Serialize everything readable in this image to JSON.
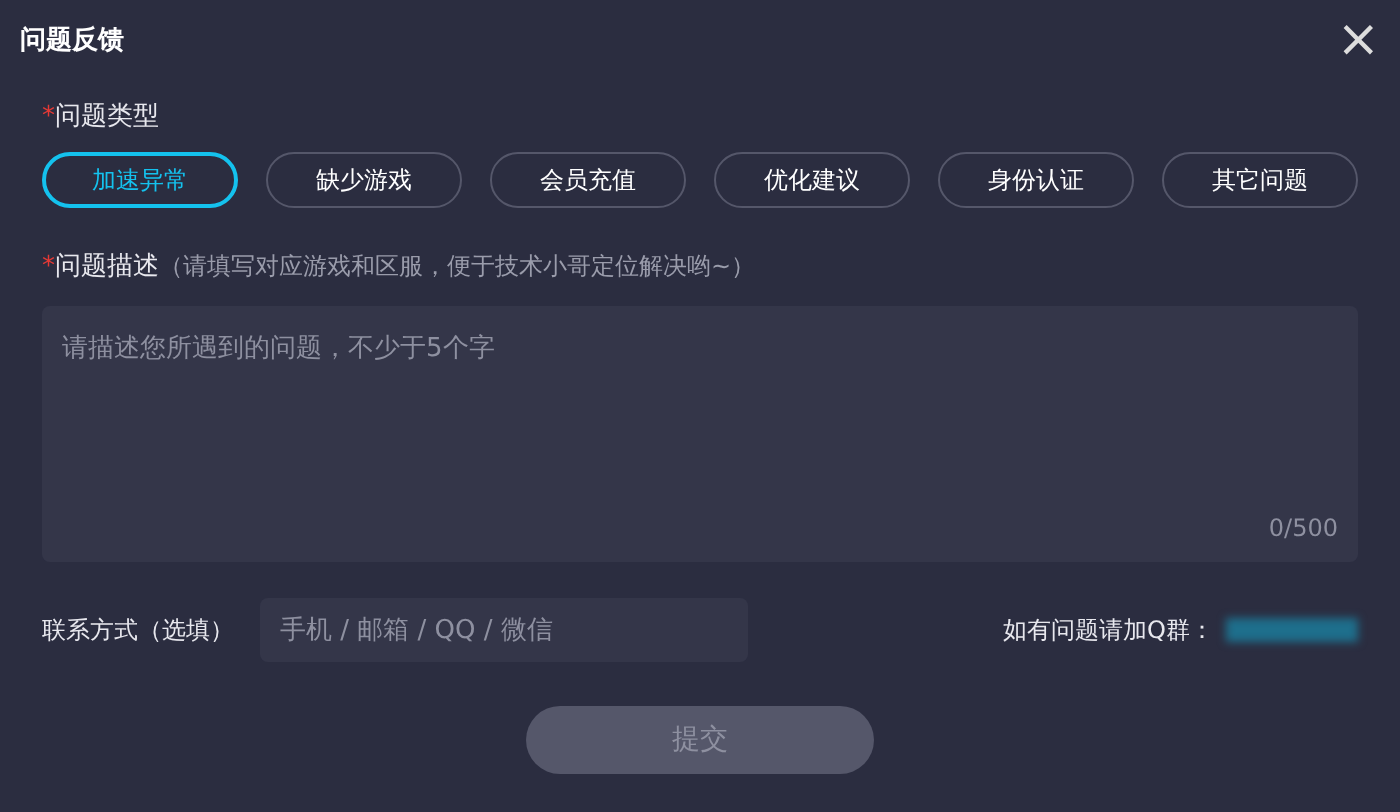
{
  "dialog": {
    "title": "问题反馈",
    "close": "×"
  },
  "type_field": {
    "required_mark": "*",
    "label": "问题类型"
  },
  "types": [
    {
      "label": "加速异常",
      "selected": true
    },
    {
      "label": "缺少游戏",
      "selected": false
    },
    {
      "label": "会员充值",
      "selected": false
    },
    {
      "label": "优化建议",
      "selected": false
    },
    {
      "label": "身份认证",
      "selected": false
    },
    {
      "label": "其它问题",
      "selected": false
    }
  ],
  "description": {
    "required_mark": "*",
    "label": "问题描述",
    "hint": "（请填写对应游戏和区服，便于技术小哥定位解决哟~）",
    "placeholder": "请描述您所遇到的问题，不少于5个字",
    "counter": "0/500"
  },
  "contact": {
    "label": "联系方式（选填）",
    "placeholder": "手机 / 邮箱 / QQ / 微信"
  },
  "qq_group": {
    "label": "如有问题请加Q群："
  },
  "submit": {
    "label": "提交",
    "disabled": true
  }
}
